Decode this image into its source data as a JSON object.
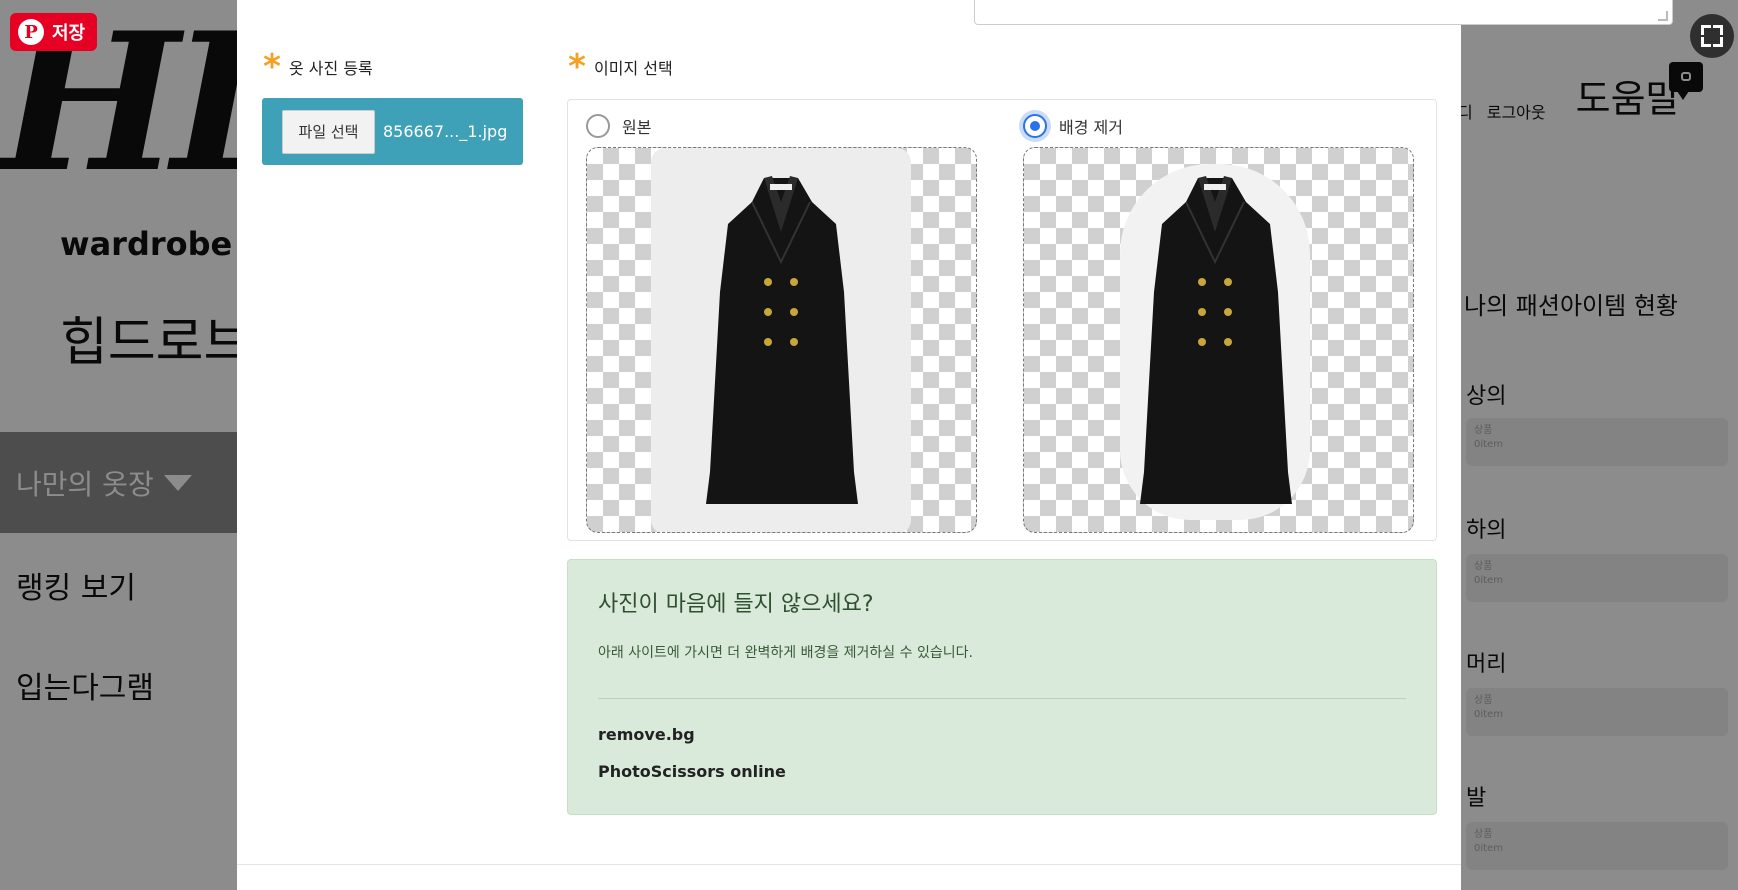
{
  "background_page": {
    "logo_big": "HIP",
    "logo_sub": "wardrobe",
    "logo_korean": "힙드로브",
    "nav": {
      "closet": "나만의 옷장",
      "ranking": "랭킹 보기",
      "gram": "입는다그램"
    },
    "top_links": [
      "디",
      "로그아웃"
    ],
    "help": "도움말",
    "stats": {
      "title": "나의 패션아이템 현황",
      "items": [
        {
          "label": "상의",
          "line1": "상품",
          "line2": "0item"
        },
        {
          "label": "하의",
          "line1": "상품",
          "line2": "0item"
        },
        {
          "label": "머리",
          "line1": "상품",
          "line2": "0item"
        },
        {
          "label": "발",
          "line1": "상품",
          "line2": "0item"
        }
      ]
    }
  },
  "modal": {
    "photo_register_label": "옷 사진 등록",
    "file_button": "파일 선택",
    "file_name": "856667..._1.jpg",
    "image_select_label": "이미지 선택",
    "options": {
      "original": "원본",
      "remove_bg": "배경 제거"
    },
    "selected_option": "remove_bg",
    "tip": {
      "title": "사진이 마음에 들지 않으세요?",
      "desc": "아래 사이트에 가시면 더 완벽하게 배경을 제거하실 수 있습니다.",
      "links": [
        "remove.bg",
        "PhotoScissors online"
      ]
    }
  },
  "chrome": {
    "pin_save": "저장",
    "pin_icon": "P",
    "fullscreen_icon": "fullscreen-icon"
  },
  "colors": {
    "upload_box": "#3fa1b7",
    "asterisk": "#f4a020",
    "tip_background": "#d9eadb",
    "radio_selected": "#2a73e8",
    "pinterest": "#e60023"
  }
}
